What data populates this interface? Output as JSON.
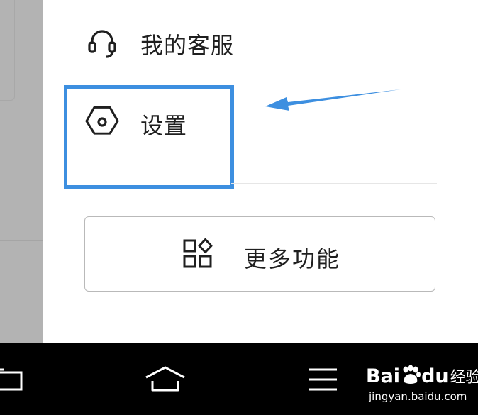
{
  "menu": {
    "customer_service": {
      "label": "我的客服",
      "icon": "headset-icon"
    },
    "settings": {
      "label": "设置",
      "icon": "hexagon-settings-icon"
    }
  },
  "more_features": {
    "label": "更多功能",
    "icon": "apps-grid-icon"
  },
  "annotation": {
    "box_color": "#3d8fe0",
    "arrow_color": "#3d8fe0"
  },
  "navbar": {
    "buttons": [
      "back-icon",
      "home-icon",
      "menu-icon"
    ]
  },
  "watermark": {
    "brand": "Bai",
    "brand_suffix": "du",
    "brand_cn": "经验",
    "url": "jingyan.baidu.com"
  }
}
